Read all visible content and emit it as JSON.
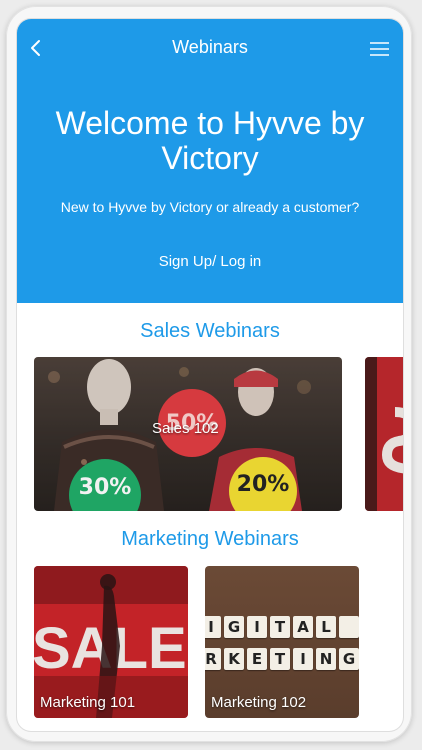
{
  "header": {
    "title": "Webinars",
    "back_icon": "chevron-left-icon",
    "menu_icon": "hamburger-menu-icon"
  },
  "hero": {
    "heading": "Welcome to Hyvve by Victory",
    "subtitle": "New to Hyvve by Victory or already a customer?",
    "signin_link": "Sign Up/ Log in"
  },
  "sections": {
    "sales": {
      "title": "Sales Webinars",
      "cards": [
        {
          "label": "Sales 102"
        }
      ],
      "badges": [
        "50%",
        "30%",
        "20%"
      ]
    },
    "marketing": {
      "title": "Marketing Webinars",
      "cards": [
        {
          "label": "Marketing 101",
          "image_text": "SALE"
        },
        {
          "label": "Marketing 102",
          "image_text_lines": [
            "DIGITAL",
            "MARKETING"
          ]
        }
      ]
    }
  },
  "colors": {
    "accent": "#1e9ae8",
    "background": "#ffffff"
  }
}
